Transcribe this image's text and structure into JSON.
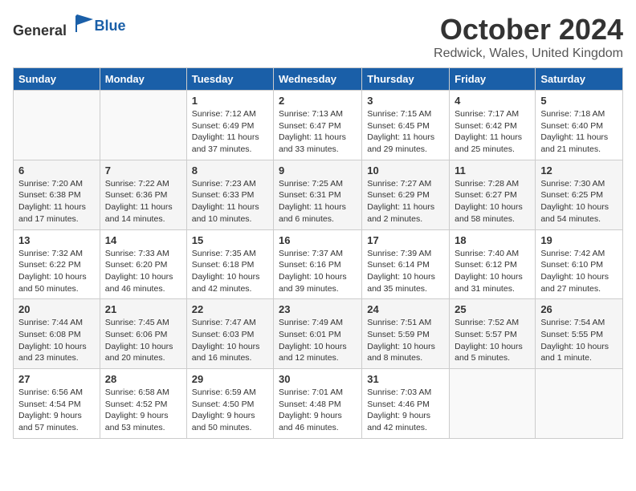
{
  "logo": {
    "general": "General",
    "blue": "Blue"
  },
  "title": "October 2024",
  "location": "Redwick, Wales, United Kingdom",
  "headers": [
    "Sunday",
    "Monday",
    "Tuesday",
    "Wednesday",
    "Thursday",
    "Friday",
    "Saturday"
  ],
  "weeks": [
    [
      {
        "day": "",
        "info": ""
      },
      {
        "day": "",
        "info": ""
      },
      {
        "day": "1",
        "info": "Sunrise: 7:12 AM\nSunset: 6:49 PM\nDaylight: 11 hours and 37 minutes."
      },
      {
        "day": "2",
        "info": "Sunrise: 7:13 AM\nSunset: 6:47 PM\nDaylight: 11 hours and 33 minutes."
      },
      {
        "day": "3",
        "info": "Sunrise: 7:15 AM\nSunset: 6:45 PM\nDaylight: 11 hours and 29 minutes."
      },
      {
        "day": "4",
        "info": "Sunrise: 7:17 AM\nSunset: 6:42 PM\nDaylight: 11 hours and 25 minutes."
      },
      {
        "day": "5",
        "info": "Sunrise: 7:18 AM\nSunset: 6:40 PM\nDaylight: 11 hours and 21 minutes."
      }
    ],
    [
      {
        "day": "6",
        "info": "Sunrise: 7:20 AM\nSunset: 6:38 PM\nDaylight: 11 hours and 17 minutes."
      },
      {
        "day": "7",
        "info": "Sunrise: 7:22 AM\nSunset: 6:36 PM\nDaylight: 11 hours and 14 minutes."
      },
      {
        "day": "8",
        "info": "Sunrise: 7:23 AM\nSunset: 6:33 PM\nDaylight: 11 hours and 10 minutes."
      },
      {
        "day": "9",
        "info": "Sunrise: 7:25 AM\nSunset: 6:31 PM\nDaylight: 11 hours and 6 minutes."
      },
      {
        "day": "10",
        "info": "Sunrise: 7:27 AM\nSunset: 6:29 PM\nDaylight: 11 hours and 2 minutes."
      },
      {
        "day": "11",
        "info": "Sunrise: 7:28 AM\nSunset: 6:27 PM\nDaylight: 10 hours and 58 minutes."
      },
      {
        "day": "12",
        "info": "Sunrise: 7:30 AM\nSunset: 6:25 PM\nDaylight: 10 hours and 54 minutes."
      }
    ],
    [
      {
        "day": "13",
        "info": "Sunrise: 7:32 AM\nSunset: 6:22 PM\nDaylight: 10 hours and 50 minutes."
      },
      {
        "day": "14",
        "info": "Sunrise: 7:33 AM\nSunset: 6:20 PM\nDaylight: 10 hours and 46 minutes."
      },
      {
        "day": "15",
        "info": "Sunrise: 7:35 AM\nSunset: 6:18 PM\nDaylight: 10 hours and 42 minutes."
      },
      {
        "day": "16",
        "info": "Sunrise: 7:37 AM\nSunset: 6:16 PM\nDaylight: 10 hours and 39 minutes."
      },
      {
        "day": "17",
        "info": "Sunrise: 7:39 AM\nSunset: 6:14 PM\nDaylight: 10 hours and 35 minutes."
      },
      {
        "day": "18",
        "info": "Sunrise: 7:40 AM\nSunset: 6:12 PM\nDaylight: 10 hours and 31 minutes."
      },
      {
        "day": "19",
        "info": "Sunrise: 7:42 AM\nSunset: 6:10 PM\nDaylight: 10 hours and 27 minutes."
      }
    ],
    [
      {
        "day": "20",
        "info": "Sunrise: 7:44 AM\nSunset: 6:08 PM\nDaylight: 10 hours and 23 minutes."
      },
      {
        "day": "21",
        "info": "Sunrise: 7:45 AM\nSunset: 6:06 PM\nDaylight: 10 hours and 20 minutes."
      },
      {
        "day": "22",
        "info": "Sunrise: 7:47 AM\nSunset: 6:03 PM\nDaylight: 10 hours and 16 minutes."
      },
      {
        "day": "23",
        "info": "Sunrise: 7:49 AM\nSunset: 6:01 PM\nDaylight: 10 hours and 12 minutes."
      },
      {
        "day": "24",
        "info": "Sunrise: 7:51 AM\nSunset: 5:59 PM\nDaylight: 10 hours and 8 minutes."
      },
      {
        "day": "25",
        "info": "Sunrise: 7:52 AM\nSunset: 5:57 PM\nDaylight: 10 hours and 5 minutes."
      },
      {
        "day": "26",
        "info": "Sunrise: 7:54 AM\nSunset: 5:55 PM\nDaylight: 10 hours and 1 minute."
      }
    ],
    [
      {
        "day": "27",
        "info": "Sunrise: 6:56 AM\nSunset: 4:54 PM\nDaylight: 9 hours and 57 minutes."
      },
      {
        "day": "28",
        "info": "Sunrise: 6:58 AM\nSunset: 4:52 PM\nDaylight: 9 hours and 53 minutes."
      },
      {
        "day": "29",
        "info": "Sunrise: 6:59 AM\nSunset: 4:50 PM\nDaylight: 9 hours and 50 minutes."
      },
      {
        "day": "30",
        "info": "Sunrise: 7:01 AM\nSunset: 4:48 PM\nDaylight: 9 hours and 46 minutes."
      },
      {
        "day": "31",
        "info": "Sunrise: 7:03 AM\nSunset: 4:46 PM\nDaylight: 9 hours and 42 minutes."
      },
      {
        "day": "",
        "info": ""
      },
      {
        "day": "",
        "info": ""
      }
    ]
  ]
}
